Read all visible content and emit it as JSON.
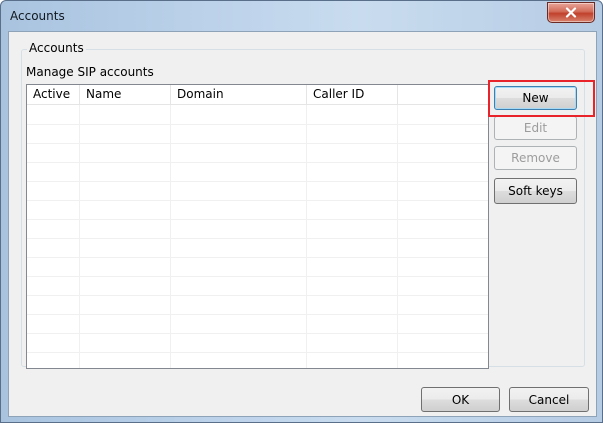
{
  "window": {
    "title": "Accounts"
  },
  "group": {
    "legend": "Accounts",
    "description": "Manage SIP accounts"
  },
  "table": {
    "columns": [
      "Active",
      "Name",
      "Domain",
      "Caller ID",
      ""
    ],
    "rows": []
  },
  "buttons": {
    "new": "New",
    "edit": "Edit",
    "remove": "Remove",
    "soft_keys": "Soft keys",
    "ok": "OK",
    "cancel": "Cancel"
  },
  "icons": {
    "close": "close-x-icon"
  },
  "colors": {
    "highlight": "#e8232a"
  }
}
